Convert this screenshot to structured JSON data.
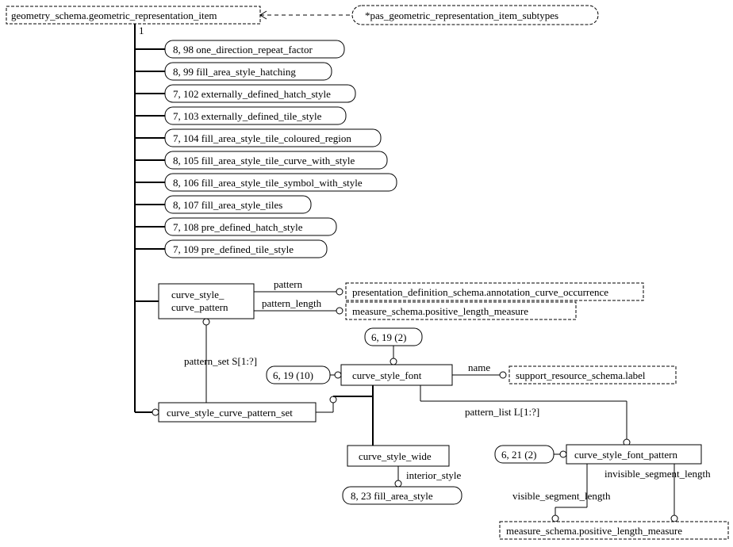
{
  "chart_data": {
    "type": "diagram",
    "title": "EXPRESS-G diagram",
    "root": "geometry_schema.geometric_representation_item",
    "constraint": "*pas_geometric_representation_item_subtypes",
    "subtypes_refs": [
      {
        "page": "8, 98",
        "name": "one_direction_repeat_factor"
      },
      {
        "page": "8, 99",
        "name": "fill_area_style_hatching"
      },
      {
        "page": "7, 102",
        "name": "externally_defined_hatch_style"
      },
      {
        "page": "7, 103",
        "name": "externally_defined_tile_style"
      },
      {
        "page": "7, 104",
        "name": "fill_area_style_tile_coloured_region"
      },
      {
        "page": "8, 105",
        "name": "fill_area_style_tile_curve_with_style"
      },
      {
        "page": "8, 106",
        "name": "fill_area_style_tile_symbol_with_style"
      },
      {
        "page": "8, 107",
        "name": "fill_area_style_tiles"
      },
      {
        "page": "7, 108",
        "name": "pre_defined_hatch_style"
      },
      {
        "page": "7, 109",
        "name": "pre_defined_tile_style"
      }
    ],
    "entities": [
      "curve_style_curve_pattern",
      "curve_style_curve_pattern_set",
      "curve_style_font",
      "curve_style_wide",
      "curve_style_font_pattern"
    ],
    "attributes": [
      {
        "from": "curve_style_curve_pattern",
        "name": "pattern",
        "to": "presentation_definition_schema.annotation_curve_occurrence"
      },
      {
        "from": "curve_style_curve_pattern",
        "name": "pattern_length",
        "to": "measure_schema.positive_length_measure"
      },
      {
        "from": "curve_style_curve_pattern_set",
        "name": "pattern_set S[1:?]",
        "to": "curve_style_curve_pattern"
      },
      {
        "from": "curve_style_font",
        "name": "name",
        "to": "support_resource_schema.label"
      },
      {
        "from": "curve_style_font",
        "name": "pattern_list L[1:?]",
        "to": "curve_style_font_pattern"
      },
      {
        "from": "curve_style_wide",
        "name": "interior_style",
        "to": "8, 23 fill_area_style"
      },
      {
        "from": "curve_style_font_pattern",
        "name": "visible_segment_length",
        "to": "measure_schema.positive_length_measure"
      },
      {
        "from": "curve_style_font_pattern",
        "name": "invisible_segment_length",
        "to": "measure_schema.positive_length_measure"
      }
    ],
    "page_refs": [
      "6, 19 (2)",
      "6, 19 (10)",
      "6, 21 (2)"
    ]
  },
  "root": {
    "label": "geometry_schema.geometric_representation_item"
  },
  "constraint": {
    "label": "*pas_geometric_representation_item_subtypes"
  },
  "one": "1",
  "subs": [
    {
      "text": "8, 98 one_direction_repeat_factor"
    },
    {
      "text": "8, 99 fill_area_style_hatching"
    },
    {
      "text": "7, 102 externally_defined_hatch_style"
    },
    {
      "text": "7, 103 externally_defined_tile_style"
    },
    {
      "text": "7, 104 fill_area_style_tile_coloured_region"
    },
    {
      "text": "8, 105 fill_area_style_tile_curve_with_style"
    },
    {
      "text": "8, 106 fill_area_style_tile_symbol_with_style"
    },
    {
      "text": "8, 107 fill_area_style_tiles"
    },
    {
      "text": "7, 108 pre_defined_hatch_style"
    },
    {
      "text": "7, 109 pre_defined_tile_style"
    }
  ],
  "e": {
    "cscp1": "curve_style_",
    "cscp2": "curve_pattern",
    "cscps": "curve_style_curve_pattern_set",
    "csf": "curve_style_font",
    "csw": "curve_style_wide",
    "csfp": "curve_style_font_pattern"
  },
  "attr": {
    "pattern": "pattern",
    "pattern_length": "pattern_length",
    "pattern_set": "pattern_set S[1:?]",
    "name": "name",
    "pattern_list": "pattern_list L[1:?]",
    "interior_style": "interior_style",
    "visible": "visible_segment_length",
    "invisible": "invisible_segment_length"
  },
  "ref": {
    "annot": "presentation_definition_schema.annotation_curve_occurrence",
    "plm": "measure_schema.positive_length_measure",
    "label": "support_resource_schema.label",
    "plm2": "measure_schema.positive_length_measure",
    "fas": "8, 23 fill_area_style"
  },
  "pr": {
    "a": "6, 19 (2)",
    "b": "6, 19 (10)",
    "c": "6, 21 (2)"
  }
}
